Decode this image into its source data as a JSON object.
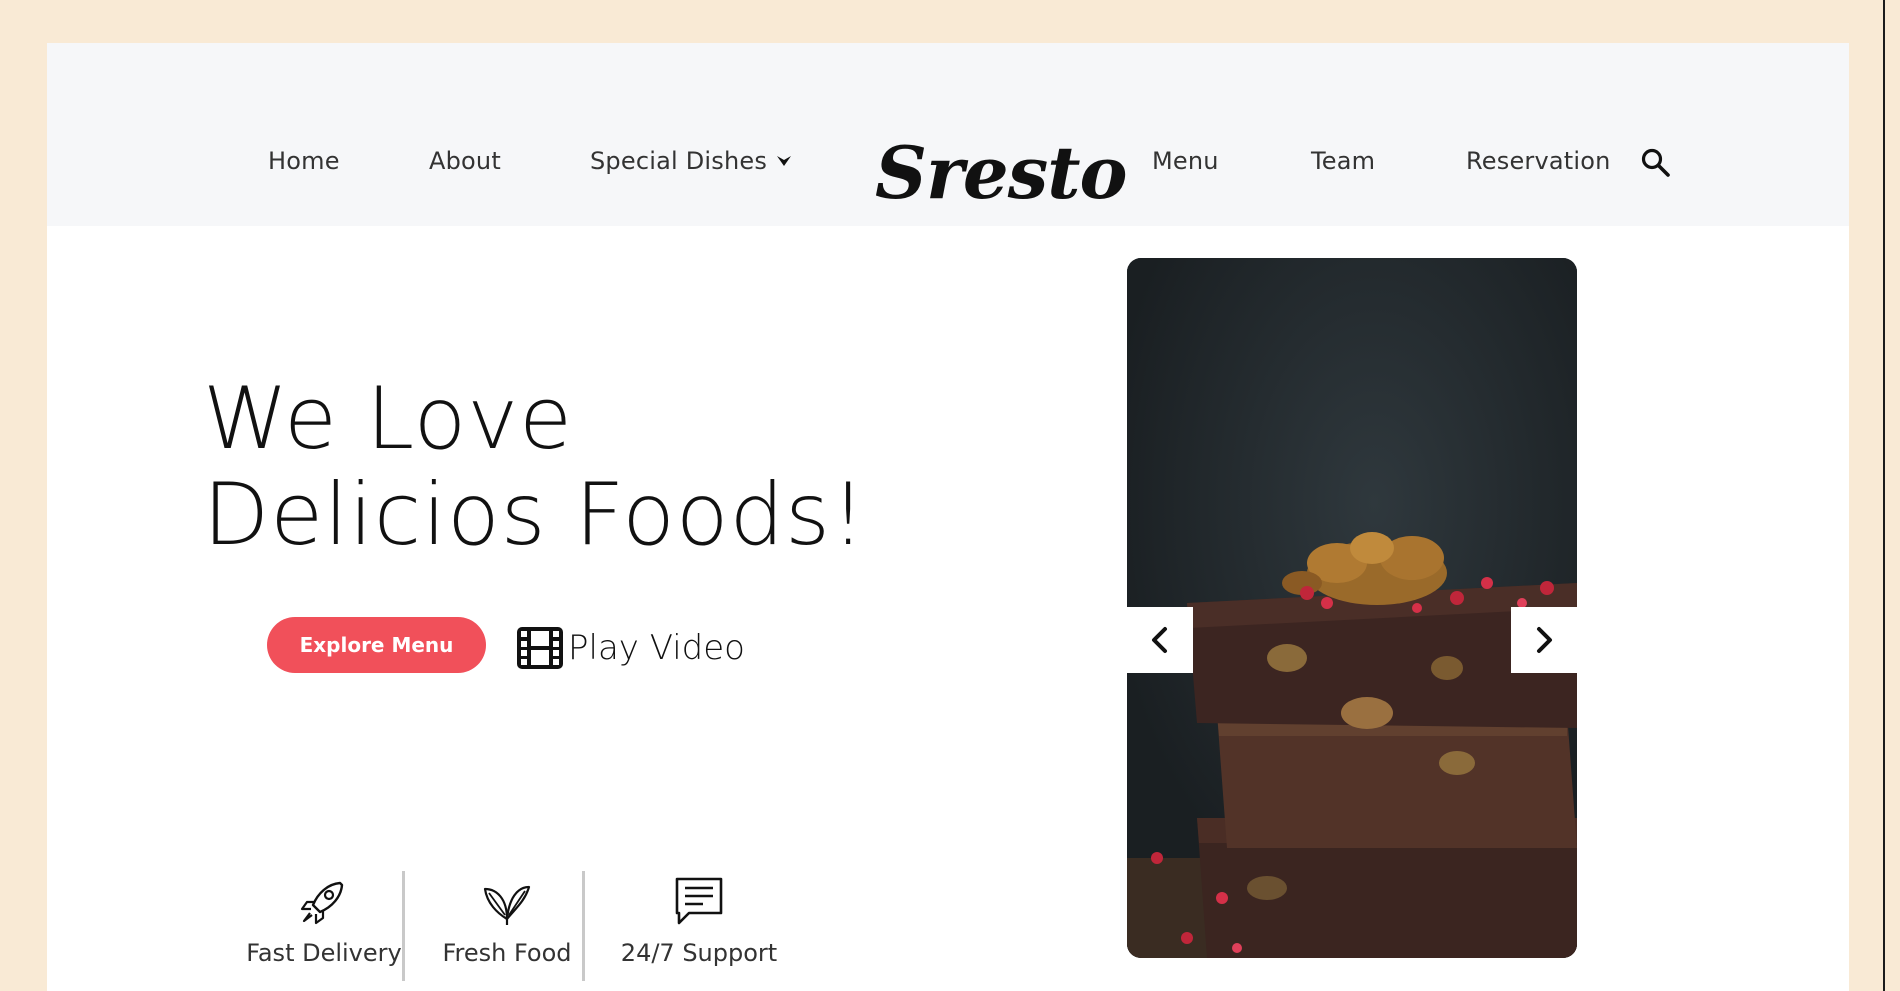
{
  "header": {
    "nav_left": [
      "Home",
      "About",
      "Special Dishes"
    ],
    "logo": "Sresto",
    "nav_right": [
      "Menu",
      "Team",
      "Reservation"
    ]
  },
  "hero": {
    "title_line1": "We Love",
    "title_line2": "Delicios Foods!",
    "explore_label": "Explore Menu",
    "play_label": "Play Video"
  },
  "features": [
    {
      "icon": "rocket-icon",
      "label": "Fast Delivery"
    },
    {
      "icon": "leaf-icon",
      "label": "Fresh Food"
    },
    {
      "icon": "chat-icon",
      "label": "24/7 Support"
    }
  ],
  "slider": {
    "image": "chocolate-brownie-image"
  },
  "colors": {
    "accent": "#f1505a",
    "page_bg": "#f9ead5",
    "header_bg": "#f6f7f9"
  }
}
